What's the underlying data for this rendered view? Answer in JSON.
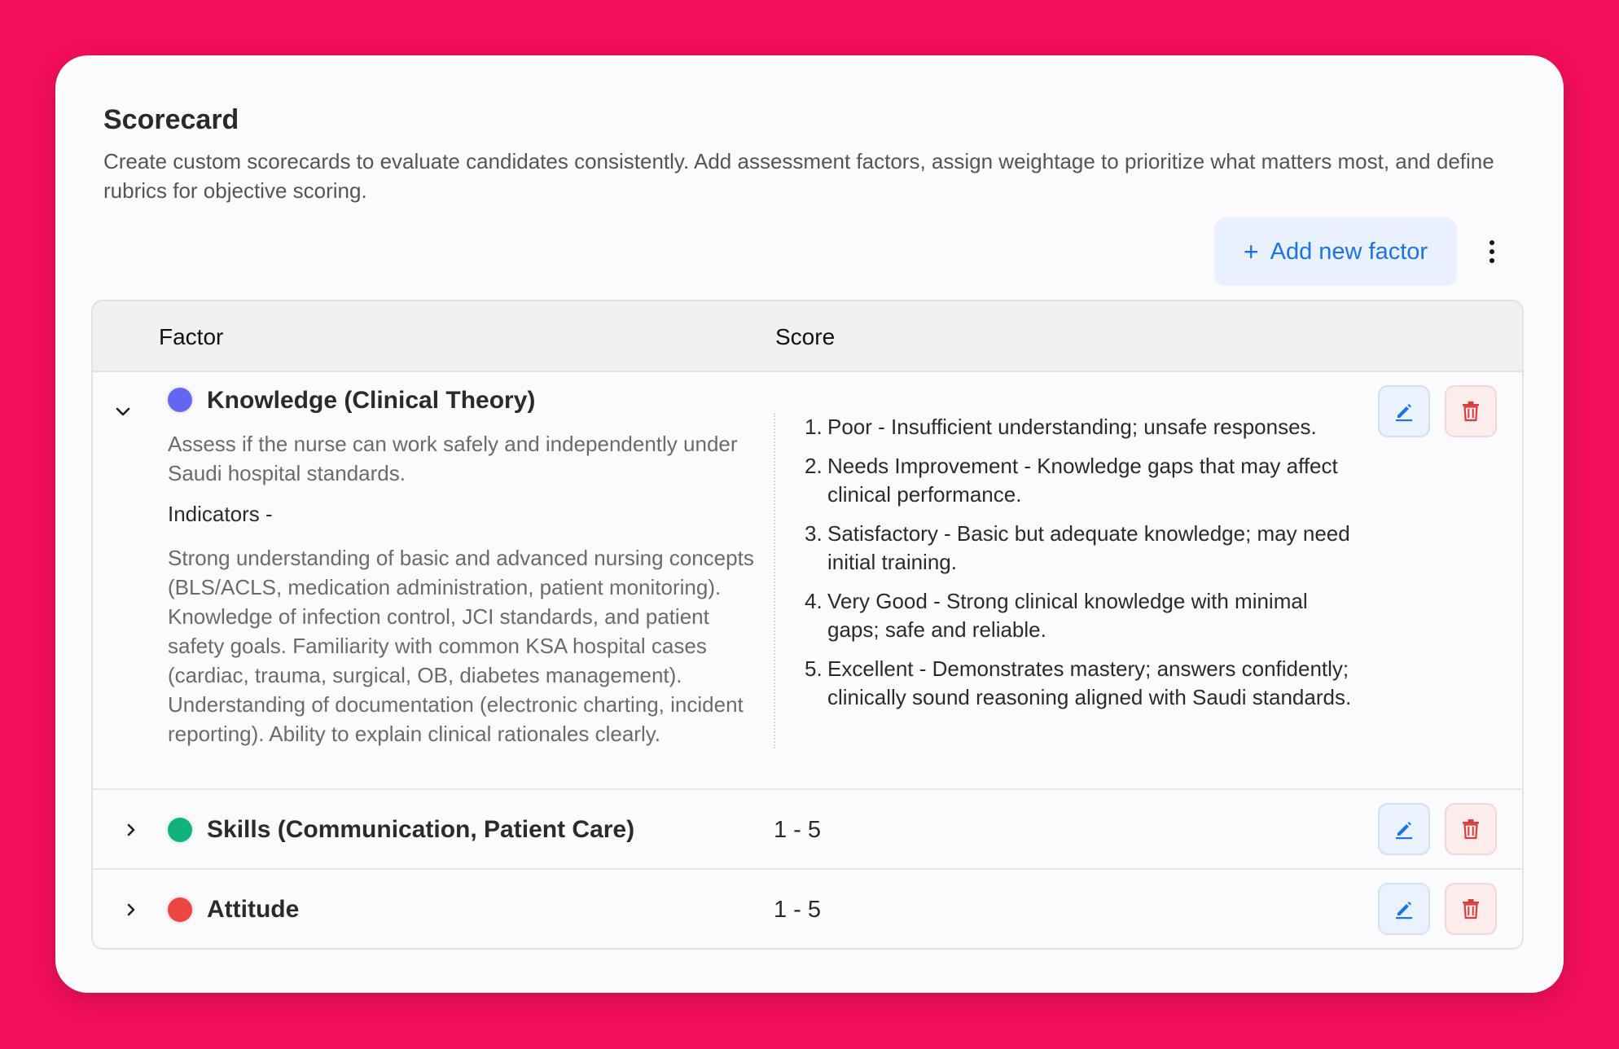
{
  "header": {
    "title": "Scorecard",
    "description": "Create custom scorecards to evaluate candidates consistently. Add assessment factors, assign weightage to prioritize what matters most, and define rubrics for objective scoring."
  },
  "toolbar": {
    "add_plus": "+",
    "add_label": "Add new factor",
    "more_icon": "kebab-menu-icon"
  },
  "table": {
    "headers": {
      "factor": "Factor",
      "score": "Score"
    },
    "factors": [
      {
        "name": "Knowledge (Clinical Theory)",
        "color": "#6366f1",
        "expanded": true,
        "description": "Assess if the nurse can work safely and independently under Saudi hospital standards.",
        "indicators_title": "Indicators -",
        "indicators": "Strong understanding of basic and advanced nursing concepts (BLS/ACLS, medication administration, patient monitoring). Knowledge of infection control, JCI standards, and patient safety goals. Familiarity with common KSA hospital cases (cardiac, trauma, surgical, OB, diabetes management). Understanding of documentation (electronic charting, incident reporting). Ability to explain clinical rationales clearly.",
        "rubric": [
          {
            "num": "1.",
            "text": "Poor - Insufficient understanding; unsafe responses."
          },
          {
            "num": "2.",
            "text": "Needs Improvement - Knowledge gaps that may affect clinical performance."
          },
          {
            "num": "3.",
            "text": "Satisfactory - Basic but adequate knowledge; may need initial training."
          },
          {
            "num": "4.",
            "text": "Very Good - Strong clinical knowledge with minimal gaps; safe and reliable."
          },
          {
            "num": "5.",
            "text": "Excellent - Demonstrates mastery; answers confidently; clinically sound reasoning aligned with Saudi standards."
          }
        ]
      },
      {
        "name": "Skills (Communication, Patient Care)",
        "color": "#12b27c",
        "expanded": false,
        "score": "1 - 5"
      },
      {
        "name": "Attitude",
        "color": "#ef4444",
        "expanded": false,
        "score": "1 - 5"
      }
    ]
  },
  "colors": {
    "background": "#f40f5a",
    "accent": "#1a73e8",
    "danger": "#d93c3c"
  }
}
